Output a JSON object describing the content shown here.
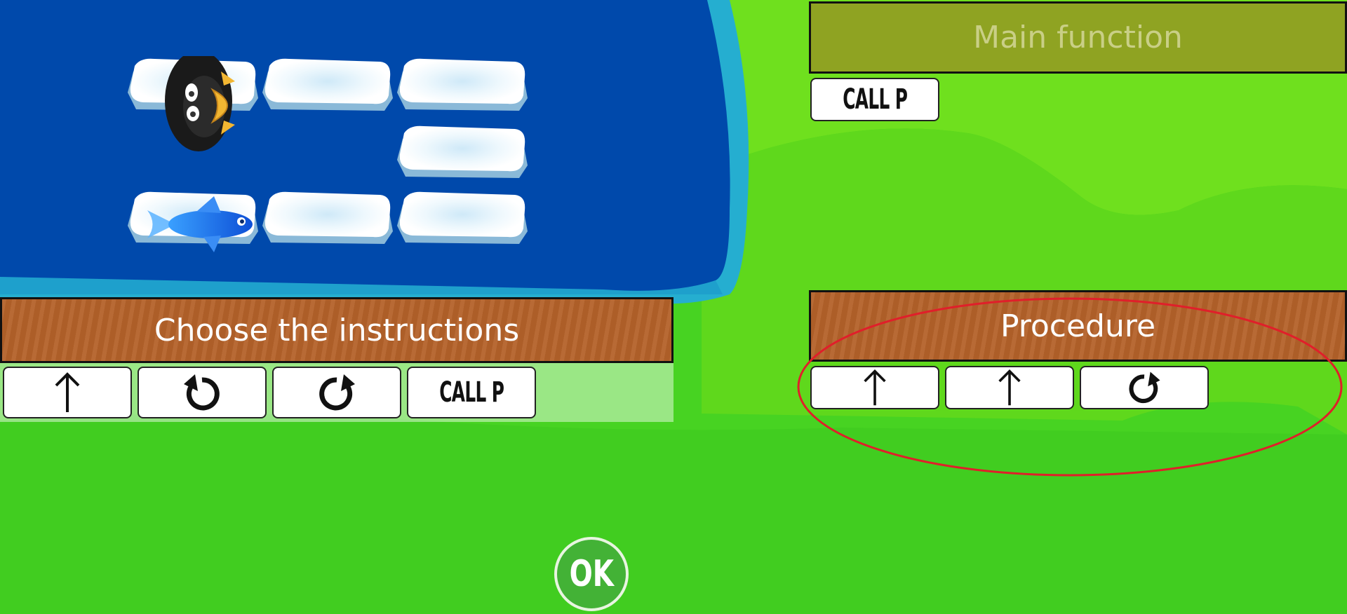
{
  "instructions_panel": {
    "title": "Choose the instructions"
  },
  "main_panel": {
    "title": "Main function"
  },
  "procedure_panel": {
    "title": "Procedure"
  },
  "palette": [
    {
      "icon": "arrow-up-icon",
      "action": "forward"
    },
    {
      "icon": "rotate-left-icon",
      "action": "turn-left"
    },
    {
      "icon": "rotate-right-icon",
      "action": "turn-right"
    },
    {
      "label": "CALL P",
      "action": "call-procedure"
    }
  ],
  "main_program": [
    {
      "label": "CALL P"
    }
  ],
  "procedure_program": [
    {
      "icon": "arrow-up-icon"
    },
    {
      "icon": "arrow-up-icon"
    },
    {
      "icon": "rotate-right-icon"
    }
  ],
  "ok_button": {
    "label": "OK"
  },
  "colors": {
    "water": "#0049ab",
    "grass": "#47d322",
    "wood": "#b4622a",
    "highlight": "#e01f2a"
  }
}
